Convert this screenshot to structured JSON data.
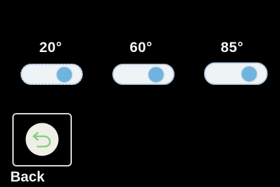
{
  "angles": [
    {
      "label": "20°",
      "toggle_on": true,
      "knob_position": 0.78
    },
    {
      "label": "60°",
      "toggle_on": true,
      "knob_position": 0.78
    },
    {
      "label": "85°",
      "toggle_on": true,
      "knob_position": 0.78
    }
  ],
  "back_button": {
    "label": "Back",
    "icon": "undo-arrow-icon"
  },
  "colors": {
    "background": "#000000",
    "toggle_track": "#eef3f6",
    "knob": "#6fb4de",
    "back_icon_circle": "#eef0e8",
    "back_icon_arrow": "#8ccf7e",
    "text": "#f4f4f4"
  }
}
